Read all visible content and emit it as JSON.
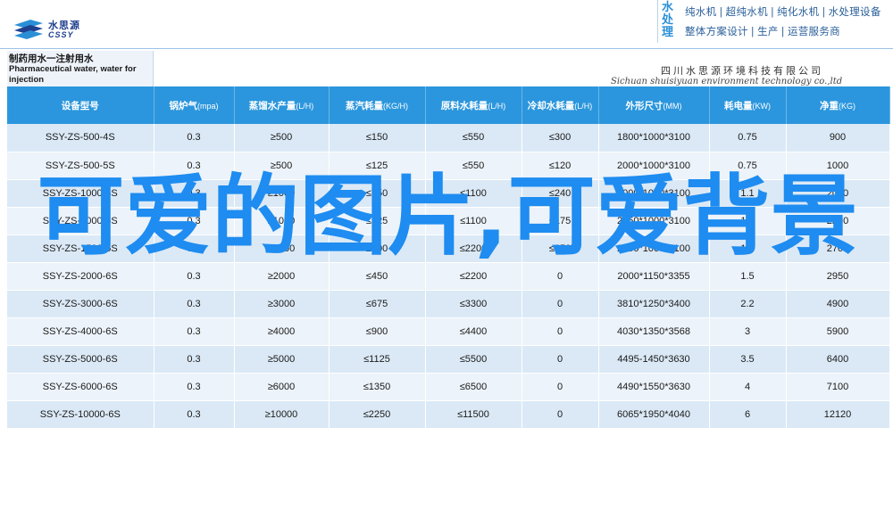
{
  "header": {
    "logo_cn": "水思源",
    "logo_en": "CSSY",
    "slogan_brand": "水处理",
    "slogan_line1": "纯水机 | 超纯水机 | 纯化水机 | 水处理设备",
    "slogan_line2": "整体方案设计 | 生产 | 运营服务商",
    "title_cn": "制药用水一注射用水",
    "title_en": "Pharmaceutical water, water for injection",
    "company_cn": "四川水思源环境科技有限公司",
    "company_en": "Sichuan shuisiyuan environment technology co.,ltd"
  },
  "table": {
    "columns": [
      {
        "name": "设备型号",
        "unit": ""
      },
      {
        "name": "锅炉气",
        "unit": "(mpa)"
      },
      {
        "name": "蒸馏水产量",
        "unit": "(L/H)"
      },
      {
        "name": "蒸汽耗量",
        "unit": "(KG/H)"
      },
      {
        "name": "原料水耗量",
        "unit": "(L/H)"
      },
      {
        "name": "冷却水耗量",
        "unit": "(L/H)"
      },
      {
        "name": "外形尺寸",
        "unit": "(MM)"
      },
      {
        "name": "耗电量",
        "unit": "(KW)"
      },
      {
        "name": "净重",
        "unit": "(KG)"
      }
    ],
    "rows": [
      [
        "SSY-ZS-500-4S",
        "0.3",
        "≥500",
        "≤150",
        "≤550",
        "≤300",
        "1800*1000*3100",
        "0.75",
        "900"
      ],
      [
        "SSY-ZS-500-5S",
        "0.3",
        "≥500",
        "≤125",
        "≤550",
        "≤120",
        "2000*1000*3100",
        "0.75",
        "1000"
      ],
      [
        "SSY-ZS-1000-5S",
        "0.3",
        "≥1000",
        "≤250",
        "≤1100",
        "≤240",
        "2000*1000*3100",
        "1.1",
        "2050"
      ],
      [
        "SSY-ZS-1000-6S",
        "0.3",
        "≥1000",
        "≤225",
        "≤1100",
        "≤175",
        "2450*1000*3100",
        "1.1",
        "2200"
      ],
      [
        "SSY-ZS-1500-6S",
        "0.3",
        "≥2000",
        "≤500",
        "≤2200",
        "≤350",
        "2450*1000*3100",
        "1.5",
        "2700"
      ],
      [
        "SSY-ZS-2000-6S",
        "0.3",
        "≥2000",
        "≤450",
        "≤2200",
        "0",
        "2000*1150*3355",
        "1.5",
        "2950"
      ],
      [
        "SSY-ZS-3000-6S",
        "0.3",
        "≥3000",
        "≤675",
        "≤3300",
        "0",
        "3810*1250*3400",
        "2.2",
        "4900"
      ],
      [
        "SSY-ZS-4000-6S",
        "0.3",
        "≥4000",
        "≤900",
        "≤4400",
        "0",
        "4030*1350*3568",
        "3",
        "5900"
      ],
      [
        "SSY-ZS-5000-6S",
        "0.3",
        "≥5000",
        "≤1125",
        "≤5500",
        "0",
        "4495-1450*3630",
        "3.5",
        "6400"
      ],
      [
        "SSY-ZS-6000-6S",
        "0.3",
        "≥6000",
        "≤1350",
        "≤6500",
        "0",
        "4490*1550*3630",
        "4",
        "7100"
      ],
      [
        "SSY-ZS-10000-6S",
        "0.3",
        "≥10000",
        "≤2250",
        "≤11500",
        "0",
        "6065*1950*4040",
        "6",
        "12120"
      ]
    ]
  },
  "overlay": {
    "headline": "可爱的图片,可爱背景"
  },
  "colors": {
    "accent": "#2b96dd",
    "overlay_text": "#1e8cf0",
    "row_odd": "#dbe9f6",
    "row_even": "#ecf3fa"
  }
}
